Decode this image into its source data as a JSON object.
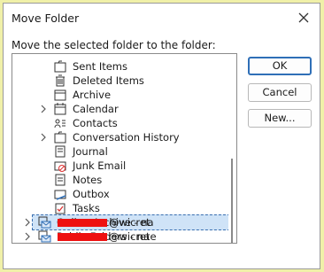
{
  "dialog": {
    "title": "Move Folder",
    "prompt": "Move the selected folder to the folder:"
  },
  "buttons": {
    "ok": "OK",
    "cancel": "Cancel",
    "new": "New..."
  },
  "tree": {
    "items": [
      {
        "label": "Sent Items",
        "icon": "folder-icon",
        "indent": 1,
        "expandable": false
      },
      {
        "label": "Deleted Items",
        "icon": "trash-icon",
        "indent": 1,
        "expandable": false
      },
      {
        "label": "Archive",
        "icon": "archive-icon",
        "indent": 1,
        "expandable": false
      },
      {
        "label": "Calendar",
        "icon": "calendar-icon",
        "indent": 1,
        "expandable": true
      },
      {
        "label": "Contacts",
        "icon": "contacts-icon",
        "indent": 1,
        "expandable": false
      },
      {
        "label": "Conversation History",
        "icon": "folder-icon",
        "indent": 1,
        "expandable": true
      },
      {
        "label": "Journal",
        "icon": "journal-icon",
        "indent": 1,
        "expandable": false
      },
      {
        "label": "Junk Email",
        "icon": "junk-icon",
        "indent": 1,
        "expandable": false
      },
      {
        "label": "Notes",
        "icon": "notes-icon",
        "indent": 1,
        "expandable": false
      },
      {
        "label": "Outbox",
        "icon": "outbox-icon",
        "indent": 1,
        "expandable": false
      },
      {
        "label": "Tasks",
        "icon": "tasks-icon",
        "indent": 1,
        "expandable": false
      },
      {
        "label": "Online Archive - na",
        "suffix": "@wicret",
        "icon": "mailbox-icon",
        "indent": 0,
        "expandable": true,
        "selected": true
      },
      {
        "label": "Public Folders - na",
        "suffix": "@wicrete",
        "icon": "mailbox-icon",
        "indent": 0,
        "expandable": true
      }
    ]
  },
  "colors": {
    "accent": "#2f6fb7",
    "redaction": "#ee1111",
    "highlight": "#f0f0a8"
  }
}
